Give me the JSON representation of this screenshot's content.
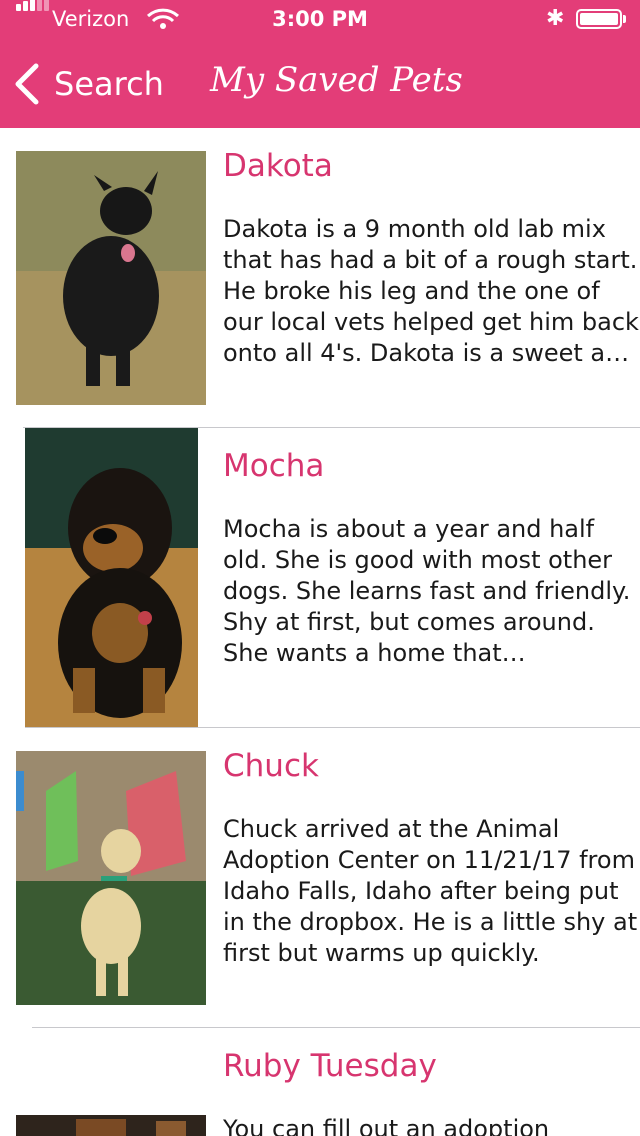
{
  "status_bar": {
    "carrier": "Verizon",
    "time": "3:00 PM"
  },
  "nav": {
    "back_label": "Search",
    "title": "My Saved Pets"
  },
  "pets": [
    {
      "name": "Dakota",
      "description": "Dakota is a 9 month old lab mix that has had a bit of a rough start. He broke his leg and the one of our local vets helped get him back onto all 4's.  Dakota is a sweet a…"
    },
    {
      "name": "Mocha",
      "description": "Mocha is about a year and half old.  She is good with most other dogs.  She learns fast and friendly.  Shy at first, but comes around.  She wants a home that…"
    },
    {
      "name": "Chuck",
      "description": "Chuck arrived at the Animal Adoption Center on 11/21/17 from Idaho Falls, Idaho after being put in the dropbox. He is a little shy at first but warms up quickly."
    },
    {
      "name": "Ruby Tuesday",
      "description": "You can fill out an adoption"
    }
  ],
  "colors": {
    "header": "#e33d78",
    "name_text": "#d7356f"
  }
}
